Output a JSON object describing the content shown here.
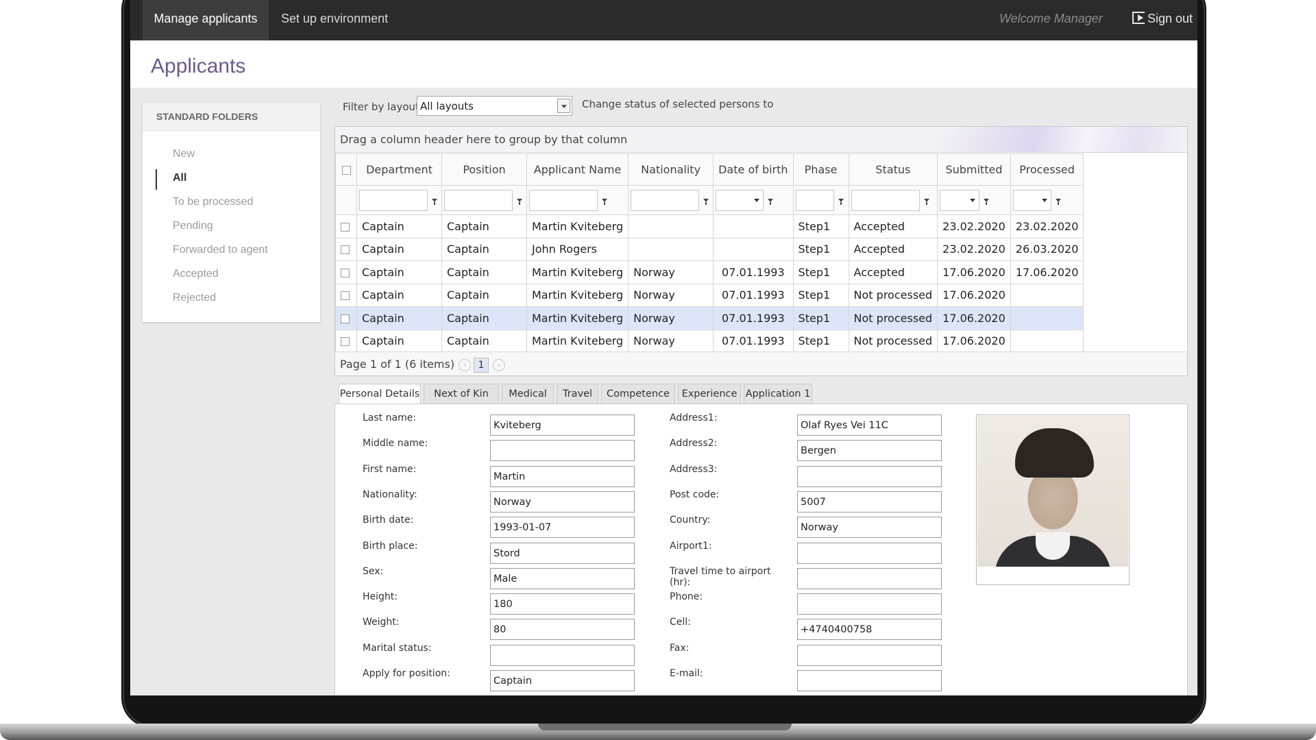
{
  "nav": {
    "manage_applicants": "Manage applicants",
    "set_up_environment": "Set up environment",
    "welcome": "Welcome Manager",
    "sign_out": "Sign out"
  },
  "page_title": "Applicants",
  "sidebar": {
    "header": "STANDARD FOLDERS",
    "items": [
      {
        "label": "New"
      },
      {
        "label": "All"
      },
      {
        "label": "To be processed"
      },
      {
        "label": "Pending"
      },
      {
        "label": "Forwarded to agent"
      },
      {
        "label": "Accepted"
      },
      {
        "label": "Rejected"
      }
    ],
    "active": "All"
  },
  "filter": {
    "label": "Filter by layout:",
    "value": "All layouts",
    "change_status_label": "Change status of selected persons to"
  },
  "grid": {
    "group_hint": "Drag a column header here to group by that column",
    "columns": [
      "Department",
      "Position",
      "Applicant Name",
      "Nationality",
      "Date of birth",
      "Phase",
      "Status",
      "Submitted",
      "Processed"
    ],
    "rows": [
      [
        "Captain",
        "Captain",
        "Martin Kviteberg",
        "",
        "",
        "Step1",
        "Accepted",
        "23.02.2020",
        "23.02.2020"
      ],
      [
        "Captain",
        "Captain",
        "John Rogers",
        "",
        "",
        "Step1",
        "Accepted",
        "23.02.2020",
        "26.03.2020"
      ],
      [
        "Captain",
        "Captain",
        "Martin Kviteberg",
        "Norway",
        "07.01.1993",
        "Step1",
        "Accepted",
        "17.06.2020",
        "17.06.2020"
      ],
      [
        "Captain",
        "Captain",
        "Martin Kviteberg",
        "Norway",
        "07.01.1993",
        "Step1",
        "Not processed",
        "17.06.2020",
        ""
      ],
      [
        "Captain",
        "Captain",
        "Martin Kviteberg",
        "Norway",
        "07.01.1993",
        "Step1",
        "Not processed",
        "17.06.2020",
        ""
      ],
      [
        "Captain",
        "Captain",
        "Martin Kviteberg",
        "Norway",
        "07.01.1993",
        "Step1",
        "Not processed",
        "17.06.2020",
        ""
      ]
    ],
    "selected_row": 5,
    "pager": {
      "summary": "Page 1 of 1 (6 items)",
      "current_page": "1"
    }
  },
  "tabs": [
    "Personal Details",
    "Next of Kin",
    "Medical",
    "Travel",
    "Competence",
    "Experience",
    "Application 1"
  ],
  "personal": {
    "left": [
      {
        "label": "Last name:",
        "value": "Kviteberg"
      },
      {
        "label": "Middle name:",
        "value": ""
      },
      {
        "label": "First name:",
        "value": "Martin"
      },
      {
        "label": "Nationality:",
        "value": "Norway"
      },
      {
        "label": "Birth date:",
        "value": "1993-01-07"
      },
      {
        "label": "Birth place:",
        "value": "Stord"
      },
      {
        "label": "Sex:",
        "value": "Male"
      },
      {
        "label": "Height:",
        "value": "180"
      },
      {
        "label": "Weight:",
        "value": "80"
      },
      {
        "label": "Marital status:",
        "value": ""
      },
      {
        "label": "Apply for position:",
        "value": "Captain"
      }
    ],
    "right": [
      {
        "label": "Address1:",
        "value": "Olaf Ryes Vei 11C"
      },
      {
        "label": "Address2:",
        "value": "Bergen"
      },
      {
        "label": "Address3:",
        "value": ""
      },
      {
        "label": "Post code:",
        "value": "5007"
      },
      {
        "label": "Country:",
        "value": "Norway"
      },
      {
        "label": "Airport1:",
        "value": ""
      },
      {
        "label": "Travel time to airport (hr):",
        "value": ""
      },
      {
        "label": "Phone:",
        "value": ""
      },
      {
        "label": "Cell:",
        "value": "+4740400758"
      },
      {
        "label": "Fax:",
        "value": ""
      },
      {
        "label": "E-mail:",
        "value": ""
      }
    ]
  }
}
